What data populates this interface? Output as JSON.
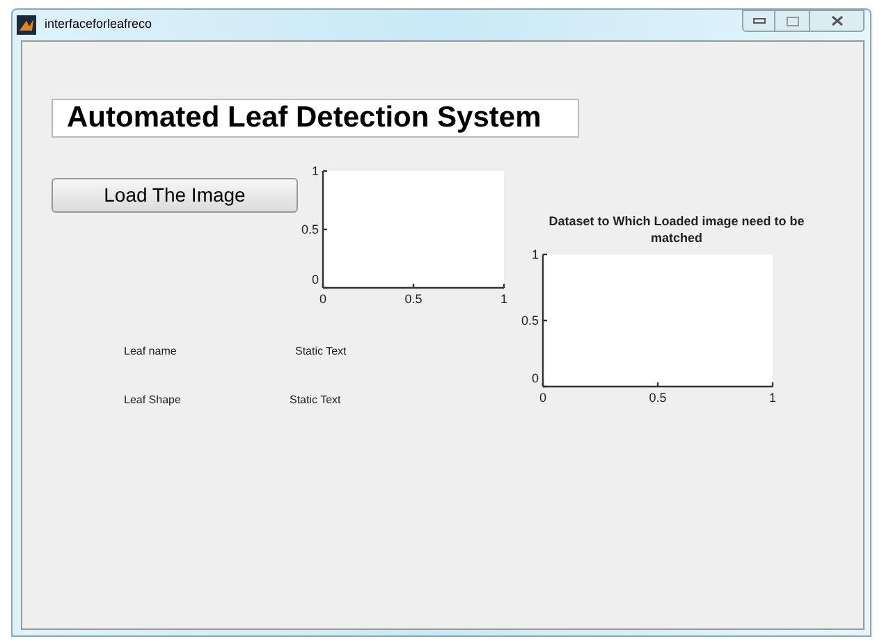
{
  "window": {
    "title": "interfaceforleafreco"
  },
  "heading": "Automated Leaf Detection System",
  "load_button": "Load The Image",
  "axes_1": {
    "chart_data": {
      "type": "line",
      "xlim": [
        0,
        1
      ],
      "ylim": [
        0,
        1
      ],
      "xticks": [
        0,
        0.5,
        1
      ],
      "yticks": [
        0,
        0.5,
        1
      ]
    }
  },
  "axes_2": {
    "chart_data": {
      "type": "line",
      "title": "Dataset to Which Loaded image need to be matched",
      "xlim": [
        0,
        1
      ],
      "ylim": [
        0,
        1
      ],
      "xticks": [
        0,
        0.5,
        1
      ],
      "yticks": [
        0,
        0.5,
        1
      ]
    }
  },
  "fields": [
    {
      "label": "Leaf name",
      "value": "Static Text"
    },
    {
      "label": "Leaf Shape",
      "value": "Static Text"
    }
  ]
}
